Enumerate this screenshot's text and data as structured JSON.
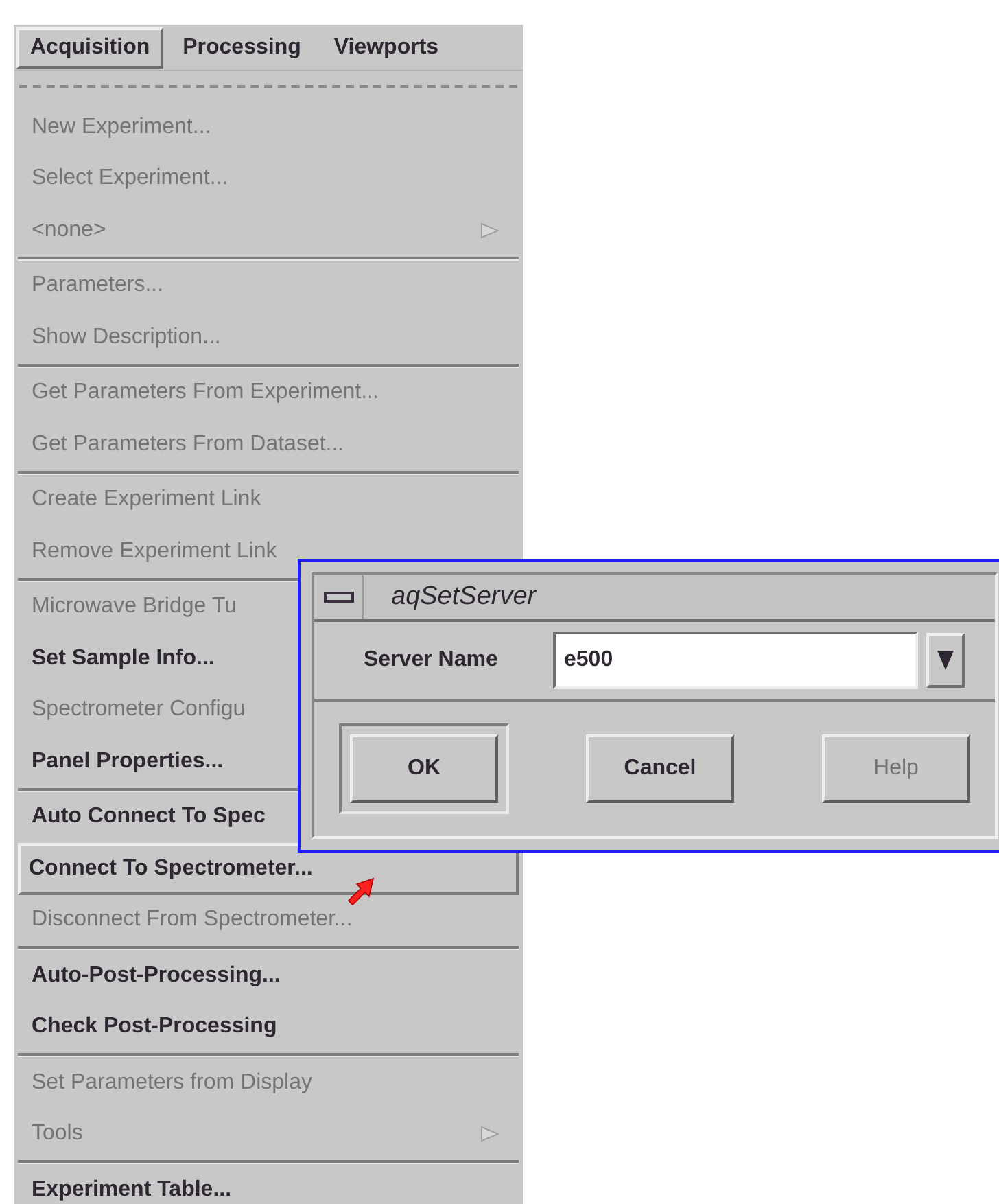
{
  "menubar": [
    {
      "label": "Acquisition",
      "selected": true
    },
    {
      "label": "Processing",
      "selected": false
    },
    {
      "label": "Viewports",
      "selected": false
    }
  ],
  "menu": [
    {
      "kind": "tearoff"
    },
    {
      "kind": "item",
      "label": "New Experiment...",
      "disabled": true,
      "selected": false,
      "submenu": false
    },
    {
      "kind": "item",
      "label": "Select Experiment...",
      "disabled": true,
      "selected": false,
      "submenu": false
    },
    {
      "kind": "item",
      "label": "<none>",
      "disabled": true,
      "selected": false,
      "submenu": true
    },
    {
      "kind": "separator"
    },
    {
      "kind": "item",
      "label": "Parameters...",
      "disabled": true,
      "selected": false,
      "submenu": false
    },
    {
      "kind": "item",
      "label": "Show Description...",
      "disabled": true,
      "selected": false,
      "submenu": false
    },
    {
      "kind": "separator"
    },
    {
      "kind": "item",
      "label": "Get Parameters From Experiment...",
      "disabled": true,
      "selected": false,
      "submenu": false
    },
    {
      "kind": "item",
      "label": "Get Parameters From Dataset...",
      "disabled": true,
      "selected": false,
      "submenu": false
    },
    {
      "kind": "separator"
    },
    {
      "kind": "item",
      "label": "Create Experiment Link",
      "disabled": true,
      "selected": false,
      "submenu": false
    },
    {
      "kind": "item",
      "label": "Remove Experiment Link",
      "disabled": true,
      "selected": false,
      "submenu": false
    },
    {
      "kind": "separator"
    },
    {
      "kind": "item",
      "label": "Microwave Bridge Tu",
      "disabled": true,
      "selected": false,
      "submenu": false
    },
    {
      "kind": "item",
      "label": "Set Sample Info...",
      "disabled": false,
      "selected": false,
      "submenu": false
    },
    {
      "kind": "item",
      "label": "Spectrometer Configu",
      "disabled": true,
      "selected": false,
      "submenu": false
    },
    {
      "kind": "item",
      "label": "Panel Properties...",
      "disabled": false,
      "selected": false,
      "submenu": false
    },
    {
      "kind": "separator"
    },
    {
      "kind": "item",
      "label": "Auto Connect To Spec",
      "disabled": false,
      "selected": false,
      "submenu": false
    },
    {
      "kind": "item",
      "label": "Connect To Spectrometer...",
      "disabled": false,
      "selected": true,
      "submenu": false
    },
    {
      "kind": "item",
      "label": "Disconnect From Spectrometer...",
      "disabled": true,
      "selected": false,
      "submenu": false
    },
    {
      "kind": "separator"
    },
    {
      "kind": "item",
      "label": "Auto-Post-Processing...",
      "disabled": false,
      "selected": false,
      "submenu": false
    },
    {
      "kind": "item",
      "label": "Check Post-Processing",
      "disabled": false,
      "selected": false,
      "submenu": false
    },
    {
      "kind": "separator"
    },
    {
      "kind": "item",
      "label": "Set Parameters from Display",
      "disabled": true,
      "selected": false,
      "submenu": false
    },
    {
      "kind": "item",
      "label": "Tools",
      "disabled": true,
      "selected": false,
      "submenu": true
    },
    {
      "kind": "separator"
    },
    {
      "kind": "item",
      "label": "Experiment Table...",
      "disabled": false,
      "selected": false,
      "submenu": false
    }
  ],
  "dialog": {
    "title": "aqSetServer",
    "field_label": "Server Name",
    "value": "e500",
    "buttons": [
      {
        "label": "OK",
        "default": true,
        "disabled": false
      },
      {
        "label": "Cancel",
        "default": false,
        "disabled": false
      },
      {
        "label": "Help",
        "default": false,
        "disabled": true
      }
    ]
  }
}
